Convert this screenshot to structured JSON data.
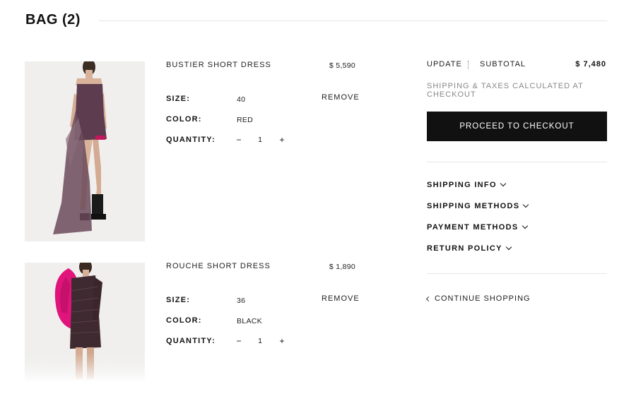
{
  "bag": {
    "title": "BAG (2)"
  },
  "items": [
    {
      "name": "BUSTIER SHORT DRESS",
      "price": "$ 5,590",
      "size_label": "SIZE:",
      "size": "40",
      "color_label": "COLOR:",
      "color": "RED",
      "quantity_label": "QUANTITY:",
      "quantity": "1",
      "remove_label": "REMOVE",
      "minus": "−",
      "plus": "+"
    },
    {
      "name": "ROUCHE SHORT DRESS",
      "price": "$ 1,890",
      "size_label": "SIZE:",
      "size": "36",
      "color_label": "COLOR:",
      "color": "BLACK",
      "quantity_label": "QUANTITY:",
      "quantity": "1",
      "remove_label": "REMOVE",
      "minus": "−",
      "plus": "+"
    }
  ],
  "summary": {
    "update_label": "UPDATE",
    "subtotal_label": "SUBTOTAL",
    "subtotal_value": "$ 7,480",
    "note": "SHIPPING & TAXES CALCULATED AT CHECKOUT",
    "checkout_label": "PROCEED TO CHECKOUT",
    "accordions": [
      "SHIPPING INFO",
      "SHIPPING METHODS",
      "PAYMENT METHODS",
      "RETURN POLICY"
    ],
    "continue_label": "CONTINUE SHOPPING"
  },
  "colors": {
    "accent": "#111111",
    "muted": "#888888",
    "rule": "#e6e6e6",
    "dress1": "#5a3a4a",
    "dress2_sleeve": "#e0147a"
  },
  "icons": [
    "chevron-down-icon",
    "chevron-left-icon",
    "minus-icon",
    "plus-icon"
  ]
}
